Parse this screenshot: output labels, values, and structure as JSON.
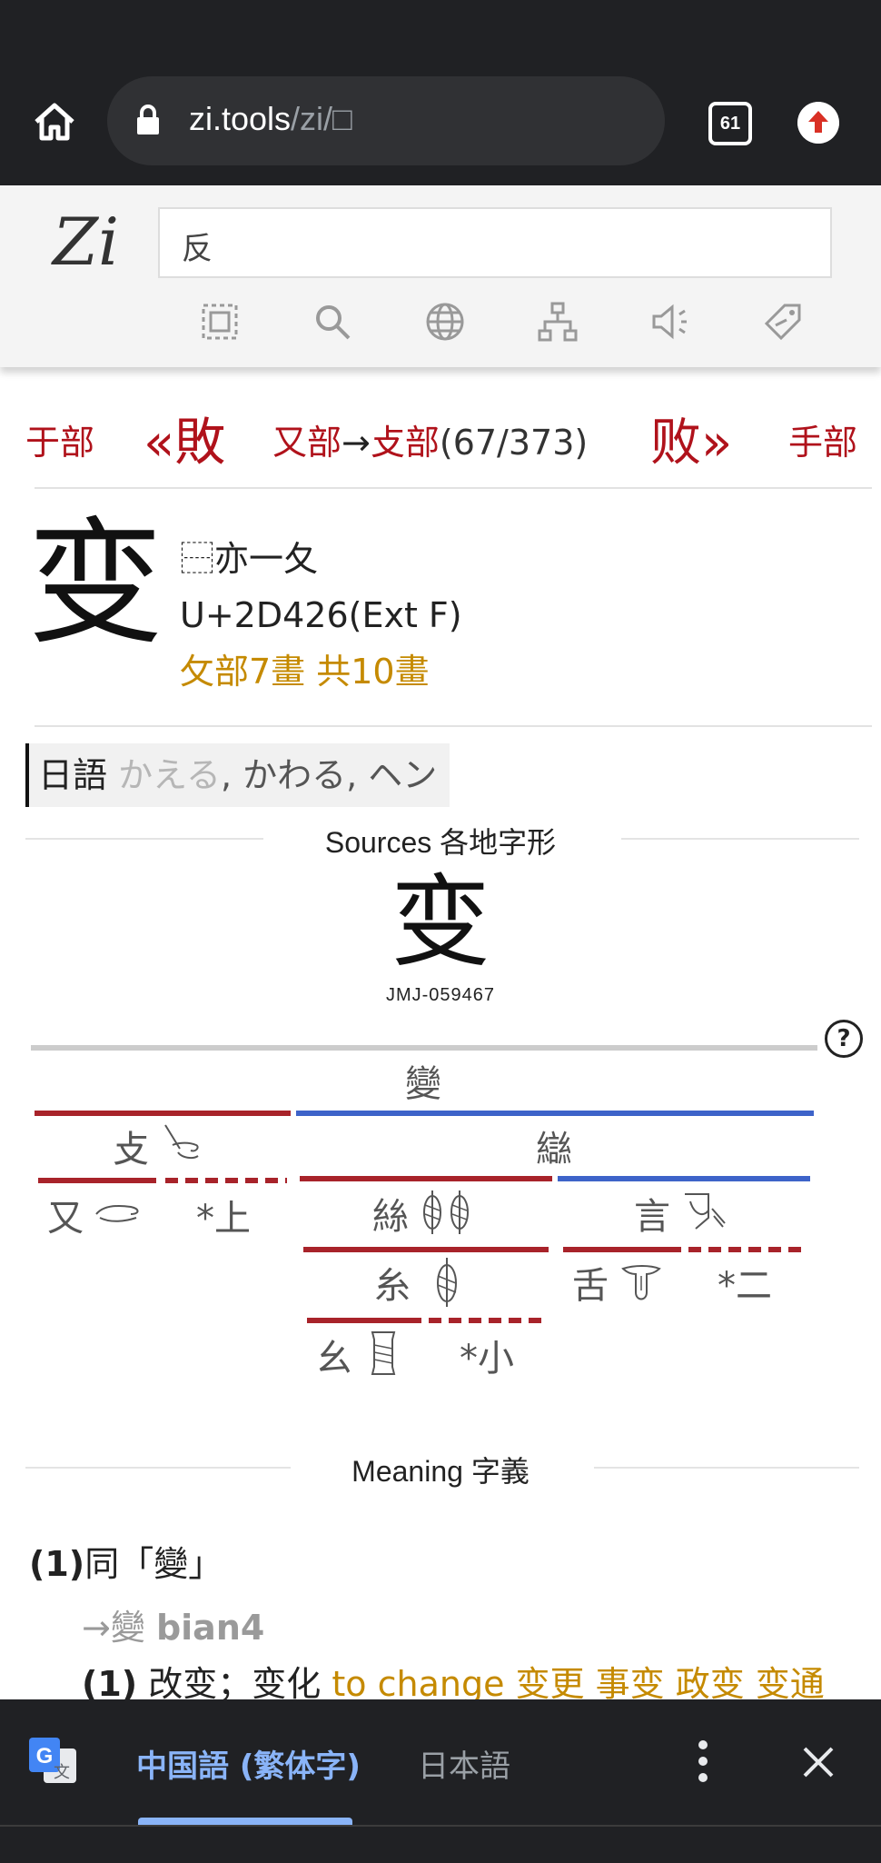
{
  "browser": {
    "url_host": "zi.tools",
    "url_path": "/zi/□",
    "tab_count": "61"
  },
  "site": {
    "logo": "Zi",
    "search_value": "反",
    "tools": [
      "select-icon",
      "search-icon",
      "globe-icon",
      "tree-icon",
      "speaker-icon",
      "tag-icon"
    ]
  },
  "nav": {
    "prev_radical": "于部",
    "prev_char": "«敗",
    "radical_path_a": "又部",
    "radical_arrow": "→",
    "radical_path_b": "攴部",
    "position": "(67/373)",
    "next_char": "败»",
    "next_radical": "手部"
  },
  "character": {
    "glyph": "变",
    "ids": "⿱亦一夂",
    "codepoint": "U+2D426(Ext F)",
    "strokes": "攵部7畫 共10畫"
  },
  "japanese": {
    "label": "日語",
    "reading_faded": "かえる",
    "readings": ", かわる, ヘン"
  },
  "sources": {
    "title": "Sources 各地字形",
    "glyph": "变",
    "code": "JMJ-059467"
  },
  "decomposition": {
    "root": "變",
    "level1_left": "攴",
    "level1_right": "䜌",
    "level2": [
      "又",
      "*上",
      "絲",
      "言"
    ],
    "level3": [
      "糸",
      "舌",
      "*二"
    ],
    "level4": [
      "幺",
      "*小"
    ]
  },
  "meaning": {
    "title": "Meaning 字義",
    "entry_num": "(1)",
    "entry_text": "同「變」",
    "ref_arrow": "→",
    "ref_char": "變",
    "ref_pinyin": "bian4",
    "sub_num": "(1)",
    "sub_text": "改变；变化",
    "sub_gloss": "to change 变更 事变 政变 变通"
  },
  "translate": {
    "tab_source": "中国語 (繁体字)",
    "tab_target": "日本語"
  }
}
